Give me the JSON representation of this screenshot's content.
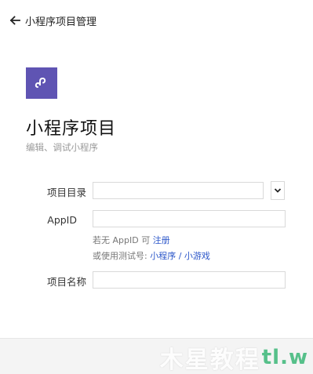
{
  "header": {
    "back_label": "小程序项目管理"
  },
  "project": {
    "title": "小程序项目",
    "subtitle": "编辑、调试小程序"
  },
  "form": {
    "dir_label": "项目目录",
    "dir_value": "",
    "appid_label": "AppID",
    "appid_value": "",
    "hint_line1_prefix": "若无 AppID 可 ",
    "hint_register_link": "注册",
    "hint_line2_prefix": "或使用测试号: ",
    "hint_miniprogram_link": "小程序",
    "hint_separator": " / ",
    "hint_minigame_link": "小游戏",
    "name_label": "项目名称",
    "name_value": ""
  },
  "watermark": {
    "text": "木星教程",
    "brand": "tl.w"
  },
  "colors": {
    "logo_bg": "#5f54b3",
    "link": "#2b56c9",
    "footer_bg": "#f4f4f4"
  },
  "icons": {
    "back": "arrow-left-icon",
    "logo": "miniprogram-logo-icon",
    "dropdown": "chevron-down-icon"
  }
}
